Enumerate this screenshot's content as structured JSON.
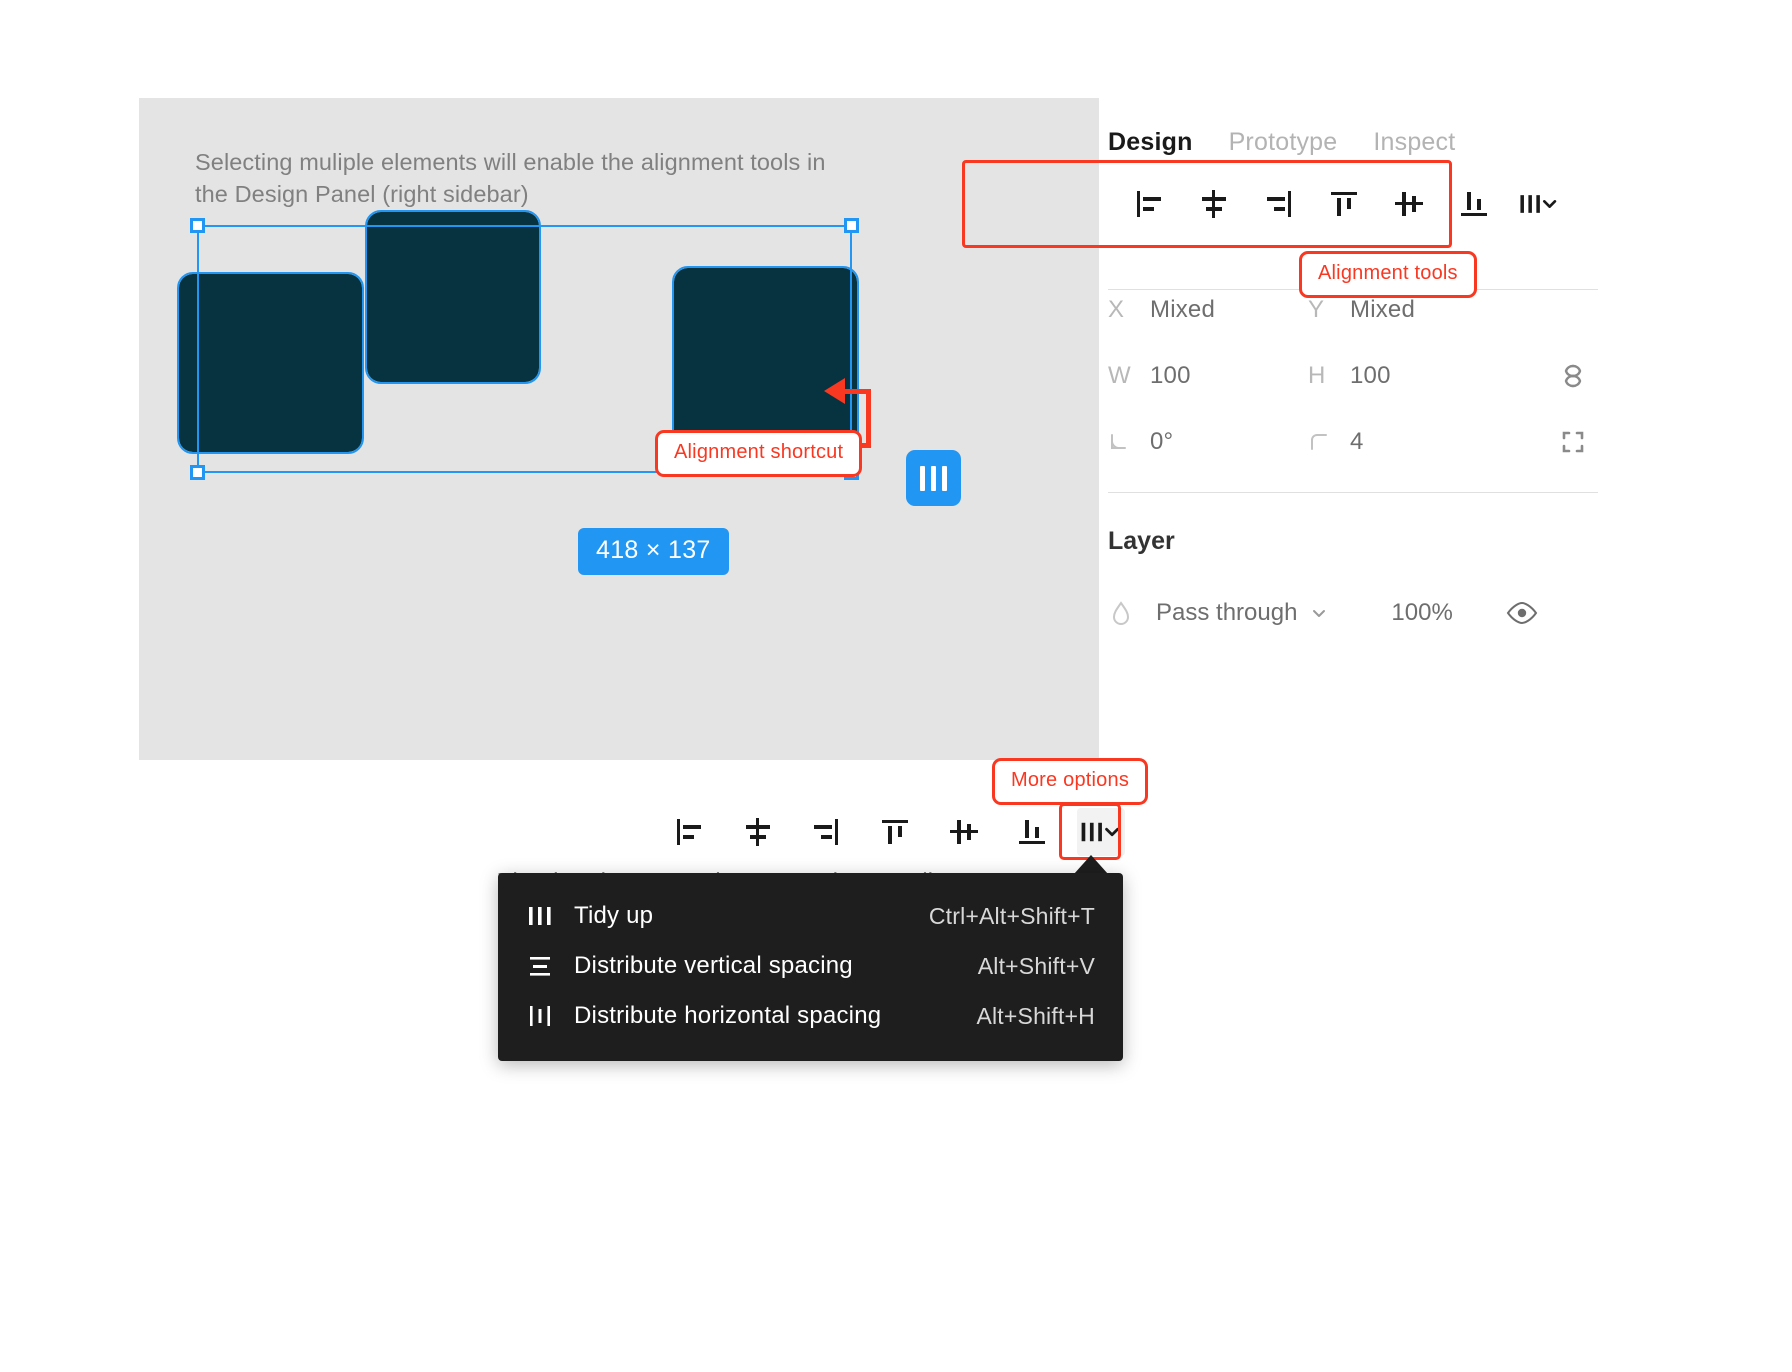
{
  "canvas": {
    "note": "Selecting muliple elements will enable the alignment tools in the Design Panel (right sidebar)",
    "size_badge": "418 × 137",
    "shortcut_icon": "align-shortcut-icon",
    "shapes": [
      {
        "name": "rectangle-1",
        "fill": "#06333f"
      },
      {
        "name": "rectangle-2",
        "fill": "#06333f"
      },
      {
        "name": "rectangle-3",
        "fill": "#06333f"
      }
    ],
    "selection_color": "#2196f3",
    "background": "#e4e4e4"
  },
  "annotations": {
    "alignment_shortcut": "Alignment shortcut",
    "alignment_tools": "Alignment tools",
    "more_options": "More options",
    "color": "#f93822"
  },
  "panel": {
    "tabs": [
      {
        "label": "Design",
        "active": true
      },
      {
        "label": "Prototype",
        "active": false
      },
      {
        "label": "Inspect",
        "active": false
      }
    ],
    "alignment_tools": [
      {
        "name": "align-left-icon",
        "title": "Align left"
      },
      {
        "name": "align-horizontal-centers-icon",
        "title": "Align horizontal centers"
      },
      {
        "name": "align-right-icon",
        "title": "Align right"
      },
      {
        "name": "align-top-icon",
        "title": "Align top"
      },
      {
        "name": "align-vertical-centers-icon",
        "title": "Align vertical centers"
      },
      {
        "name": "align-bottom-icon",
        "title": "Align bottom"
      },
      {
        "name": "distribute-more-icon",
        "title": "More align options"
      }
    ],
    "properties": [
      {
        "label_left": "X",
        "value_left": "Mixed",
        "label_right": "Y",
        "value_right": "Mixed",
        "icon": ""
      },
      {
        "label_left": "W",
        "value_left": "100",
        "label_right": "H",
        "value_right": "100",
        "icon": "constrain-proportions-icon"
      },
      {
        "label_left": "rotation",
        "value_left": "0°",
        "label_right": "corner-radius",
        "value_right": "4",
        "icon": "independent-corners-icon"
      }
    ],
    "layer": {
      "title": "Layer",
      "blend_mode": "Pass through",
      "opacity": "100%",
      "blend_icon": "blend-droplet-icon",
      "chevron_icon": "chevron-down-icon",
      "visibility_icon": "eye-icon"
    }
  },
  "bottom": {
    "note": "The dropdown reveals more options to align a group elements",
    "toolbar": [
      {
        "name": "align-left-icon"
      },
      {
        "name": "align-horizontal-centers-icon"
      },
      {
        "name": "align-right-icon"
      },
      {
        "name": "align-top-icon"
      },
      {
        "name": "align-vertical-centers-icon"
      },
      {
        "name": "align-bottom-icon"
      },
      {
        "name": "distribute-more-icon"
      }
    ],
    "menu": [
      {
        "label": "Tidy up",
        "shortcut": "Ctrl+Alt+Shift+T",
        "icon": "tidy-up-icon"
      },
      {
        "label": "Distribute vertical spacing",
        "shortcut": "Alt+Shift+V",
        "icon": "distribute-vertical-icon"
      },
      {
        "label": "Distribute horizontal spacing",
        "shortcut": "Alt+Shift+H",
        "icon": "distribute-horizontal-icon"
      }
    ]
  }
}
